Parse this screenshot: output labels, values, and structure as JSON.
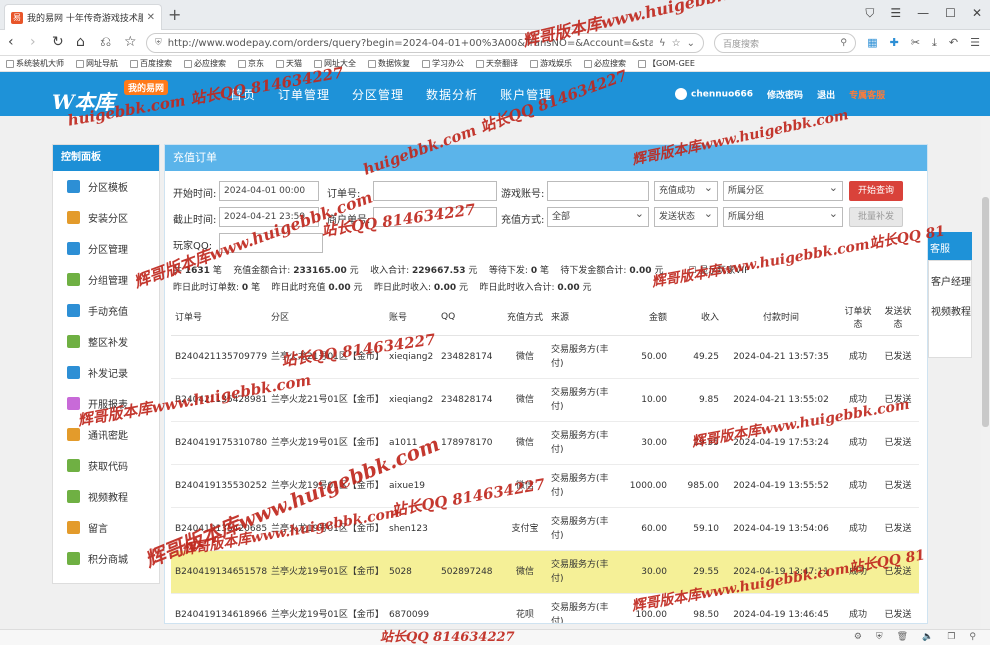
{
  "browser": {
    "tab_title": "我的易网 十年传奇游戏技术服务",
    "tab_favicon": "易",
    "url": "http://www.wodepay.com/orders/query?begin=2024-04-01+00%3A00&TransNO=&Account=&status",
    "search_placeholder": "百度搜索",
    "bookmarks": [
      "系统装机大师",
      "网址导航",
      "百度搜索",
      "必应搜索",
      "京东",
      "天猫",
      "网址大全",
      "数据恢复",
      "学习办公",
      "天奈翻译",
      "游戏娱乐",
      "必应搜索",
      "【GOM-GEE"
    ]
  },
  "header": {
    "logo_text": "W本库",
    "logo_badge": "我的易网",
    "nav": [
      "首页",
      "订单管理",
      "分区管理",
      "数据分析",
      "账户管理"
    ],
    "username": "chennuo666",
    "change_password": "修改密码",
    "logout": "退出",
    "special_service": "专属客服"
  },
  "sidebar": {
    "title": "控制面板",
    "items": [
      {
        "label": "分区模板",
        "color": "#2d8fd5"
      },
      {
        "label": "安装分区",
        "color": "#e39b2b"
      },
      {
        "label": "分区管理",
        "color": "#2d8fd5"
      },
      {
        "label": "分组管理",
        "color": "#6fb043"
      },
      {
        "label": "手动充值",
        "color": "#2d8fd5"
      },
      {
        "label": "整区补发",
        "color": "#6fb043"
      },
      {
        "label": "补发记录",
        "color": "#2d8fd5"
      },
      {
        "label": "开服报表",
        "color": "#c86ad8"
      },
      {
        "label": "通讯密匙",
        "color": "#e39b2b"
      },
      {
        "label": "获取代码",
        "color": "#6fb043"
      },
      {
        "label": "视频教程",
        "color": "#6fb043"
      },
      {
        "label": "留言",
        "color": "#e39b2b"
      },
      {
        "label": "积分商城",
        "color": "#6fb043"
      }
    ]
  },
  "panel": {
    "title": "充值订单",
    "filters": {
      "start_label": "开始时间:",
      "start_value": "2024-04-01 00:00",
      "end_label": "截止时间:",
      "end_value": "2024-04-21 23:59",
      "order_label": "订单号:",
      "account_label": "游戏账号:",
      "merchant_order_label": "商户单号:",
      "recharge_method_label": "充值方式:",
      "recharge_method_value": "全部",
      "status_value": "充值成功",
      "send_status_value": "发送状态",
      "zone_value": "所属分区",
      "group_value": "所属分组",
      "search_button": "开始查询",
      "resend_button": "批量补发",
      "extra_label": "玩家QQ:"
    },
    "summary": {
      "total_count_label": "共",
      "total_count": "1631",
      "total_count_unit": "笔",
      "recharge_total_label": "充值金额合计:",
      "recharge_total": "233165.00",
      "income_total_label": "收入合计:",
      "income_total": "229667.53",
      "waiting_label": "等待下发:",
      "waiting": "0",
      "pending_label": "待下发金额合计:",
      "pending": "0.00",
      "show_vip": "显示玩家VIP",
      "y_orders_label": "昨日此时订单数:",
      "y_orders": "0",
      "y_recharge_label": "昨日此时充值",
      "y_recharge": "0.00",
      "y_income_label": "昨日此时收入:",
      "y_income": "0.00",
      "y_income2_label": "昨日此时收入合计:",
      "y_income2": "0.00",
      "unit_yuan": "元",
      "unit_bi": "笔"
    },
    "table": {
      "headers": [
        "订单号",
        "分区",
        "账号",
        "QQ",
        "充值方式",
        "来源",
        "金额",
        "收入",
        "付款时间",
        "订单状态",
        "发送状态"
      ],
      "rows": [
        [
          "B240421135709779",
          "兰亭火龙21号01区【金币】",
          "xieqiang2",
          "234828174",
          "微信",
          "交易服务方(丰付)",
          "50.00",
          "49.25",
          "2024-04-21 13:57:35",
          "成功",
          "已发送"
        ],
        [
          "B240421135428981",
          "兰亭火龙21号01区【金币】",
          "xieqiang2",
          "234828174",
          "微信",
          "交易服务方(丰付)",
          "10.00",
          "9.85",
          "2024-04-21 13:55:02",
          "成功",
          "已发送"
        ],
        [
          "B240419175310780",
          "兰亭火龙19号01区【金币】",
          "a1011",
          "178978170",
          "微信",
          "交易服务方(丰付)",
          "30.00",
          "29.55",
          "2024-04-19 17:53:24",
          "成功",
          "已发送"
        ],
        [
          "B240419135530252",
          "兰亭火龙19号01区【金币】",
          "aixue19",
          "",
          "微信",
          "交易服务方(丰付)",
          "1000.00",
          "985.00",
          "2024-04-19 13:55:52",
          "成功",
          "已发送"
        ],
        [
          "B240419135420685",
          "兰亭火龙19号01区【金币】",
          "shen123",
          "",
          "支付宝",
          "交易服务方(丰付)",
          "60.00",
          "59.10",
          "2024-04-19 13:54:06",
          "成功",
          "已发送"
        ],
        [
          "B240419134651578",
          "兰亭火龙19号01区【金币】",
          "5028",
          "502897248",
          "微信",
          "交易服务方(丰付)",
          "30.00",
          "29.55",
          "2024-04-19 13:47:11",
          "成功",
          "已发送"
        ],
        [
          "B240419134618966",
          "兰亭火龙19号01区【金币】",
          "6870099",
          "",
          "花呗",
          "交易服务方(丰付)",
          "100.00",
          "98.50",
          "2024-04-19 13:46:45",
          "成功",
          "已发送"
        ]
      ],
      "highlight_row": 5
    }
  },
  "float_panel": {
    "title": "客服",
    "items": [
      "客户经理",
      "视频教程"
    ]
  },
  "watermarks": {
    "site": "辉哥版本库www.huigebbk.com",
    "qq": "站长QQ 814634227",
    "site_short": "辉哥版本库www.huigebbk.com站长QQ 81",
    "domain": "huigebbk.com",
    "qq_num": "814634227"
  }
}
